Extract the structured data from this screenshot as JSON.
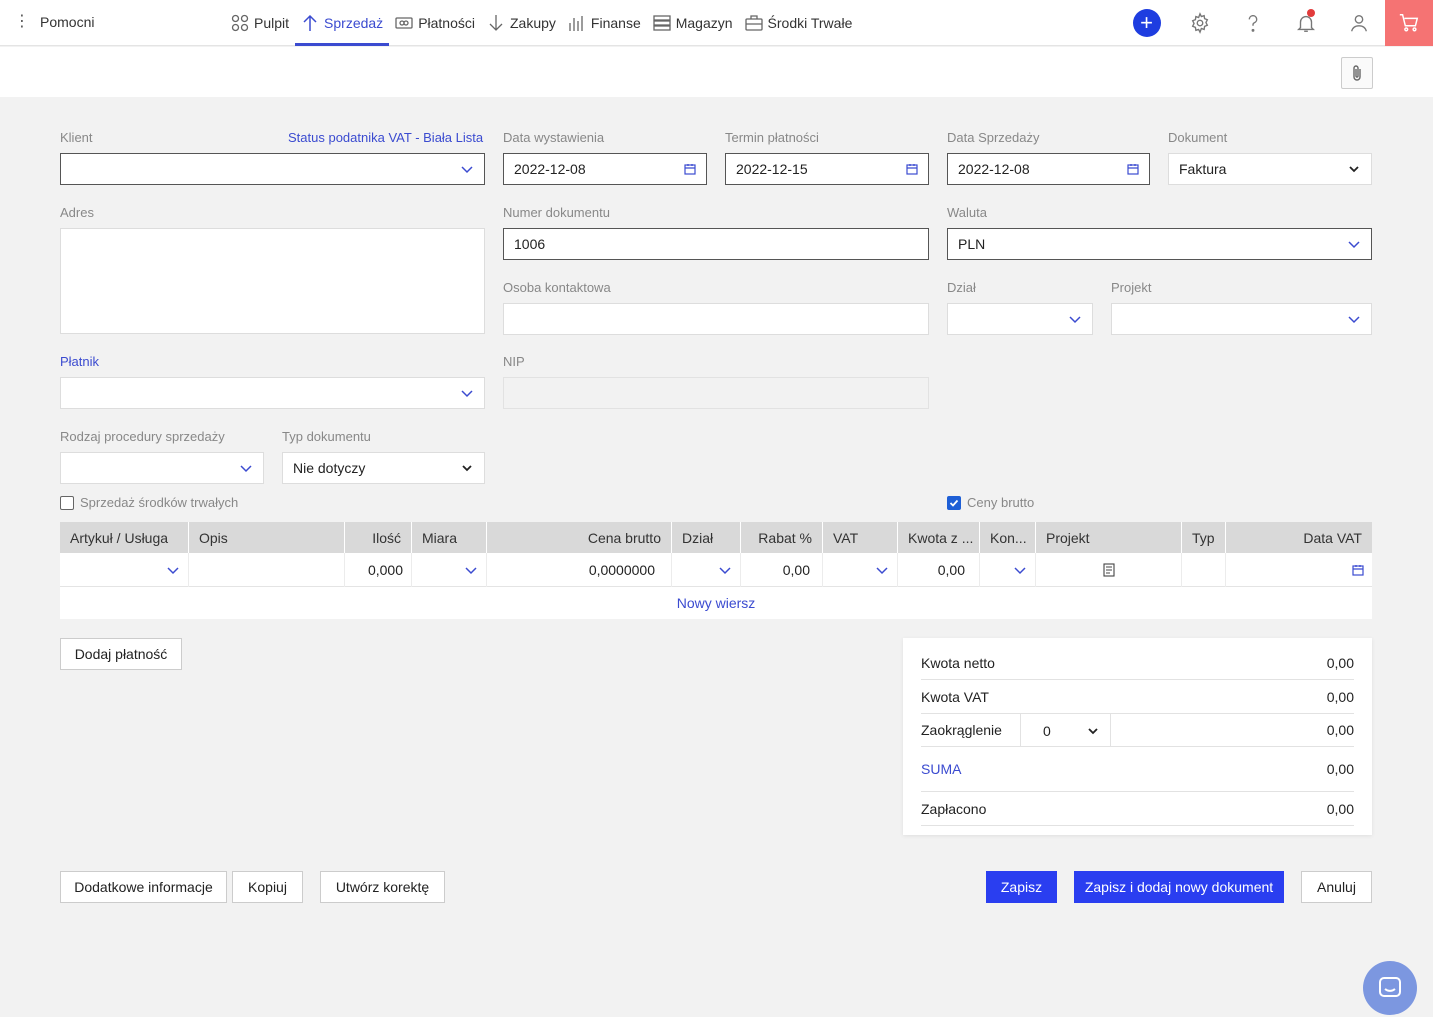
{
  "app": {
    "brand": "Pomocni"
  },
  "nav": [
    {
      "label": "Pulpit",
      "icon": "dashboard-icon",
      "active": false
    },
    {
      "label": "Sprzedaż",
      "icon": "arrow-up-icon",
      "active": true
    },
    {
      "label": "Płatności",
      "icon": "money-icon",
      "active": false
    },
    {
      "label": "Zakupy",
      "icon": "arrow-down-icon",
      "active": false
    },
    {
      "label": "Finanse",
      "icon": "bar-chart-icon",
      "active": false
    },
    {
      "label": "Magazyn",
      "icon": "warehouse-icon",
      "active": false
    },
    {
      "label": "Środki Trwałe",
      "icon": "briefcase-icon",
      "active": false
    }
  ],
  "form": {
    "klient_label": "Klient",
    "vat_status_link": "Status podatnika VAT - Biała Lista",
    "klient_value": "",
    "data_wystawienia_label": "Data wystawienia",
    "data_wystawienia": "2022-12-08",
    "termin_platnosci_label": "Termin płatności",
    "termin_platnosci": "2022-12-15",
    "data_sprzedazy_label": "Data Sprzedaży",
    "data_sprzedazy": "2022-12-08",
    "dokument_label": "Dokument",
    "dokument": "Faktura",
    "adres_label": "Adres",
    "numer_label": "Numer dokumentu",
    "numer": "1006",
    "waluta_label": "Waluta",
    "waluta": "PLN",
    "osoba_label": "Osoba kontaktowa",
    "dzial_label": "Dział",
    "projekt_label": "Projekt",
    "platnik_label": "Płatnik",
    "nip_label": "NIP",
    "procedura_label": "Rodzaj procedury sprzedaży",
    "typ_dok_label": "Typ dokumentu",
    "typ_dok": "Nie dotyczy",
    "sprzedaz_srodkow_label": "Sprzedaż środków trwałych",
    "ceny_brutto_label": "Ceny brutto",
    "ceny_brutto_checked": true
  },
  "grid": {
    "columns": [
      "Artykuł / Usługa",
      "Opis",
      "Ilość",
      "Miara",
      "Cena brutto",
      "Dział",
      "Rabat %",
      "VAT",
      "Kwota z ...",
      "Kon...",
      "Projekt",
      "Typ",
      "Data VAT"
    ],
    "row": {
      "ilosc": "0,000",
      "cena": "0,0000000",
      "rabat": "0,00",
      "kwota": "0,00"
    },
    "new_row": "Nowy wiersz"
  },
  "buttons": {
    "dodaj_platnosc": "Dodaj płatność",
    "dodatkowe": "Dodatkowe informacje",
    "kopiuj": "Kopiuj",
    "korekta": "Utwórz korektę",
    "zapisz": "Zapisz",
    "zapisz_nowy": "Zapisz i dodaj nowy dokument",
    "anuluj": "Anuluj"
  },
  "totals": {
    "netto_label": "Kwota netto",
    "netto": "0,00",
    "vat_label": "Kwota VAT",
    "vat": "0,00",
    "zaokr_label": "Zaokrąglenie",
    "zaokr_select": "0",
    "zaokr": "0,00",
    "suma_label": "SUMA",
    "suma": "0,00",
    "zaplacono_label": "Zapłacono",
    "zaplacono": "0,00"
  },
  "colors": {
    "accent": "#3b4bd0",
    "primary_button": "#2a3ef0",
    "cart": "#f57373"
  }
}
